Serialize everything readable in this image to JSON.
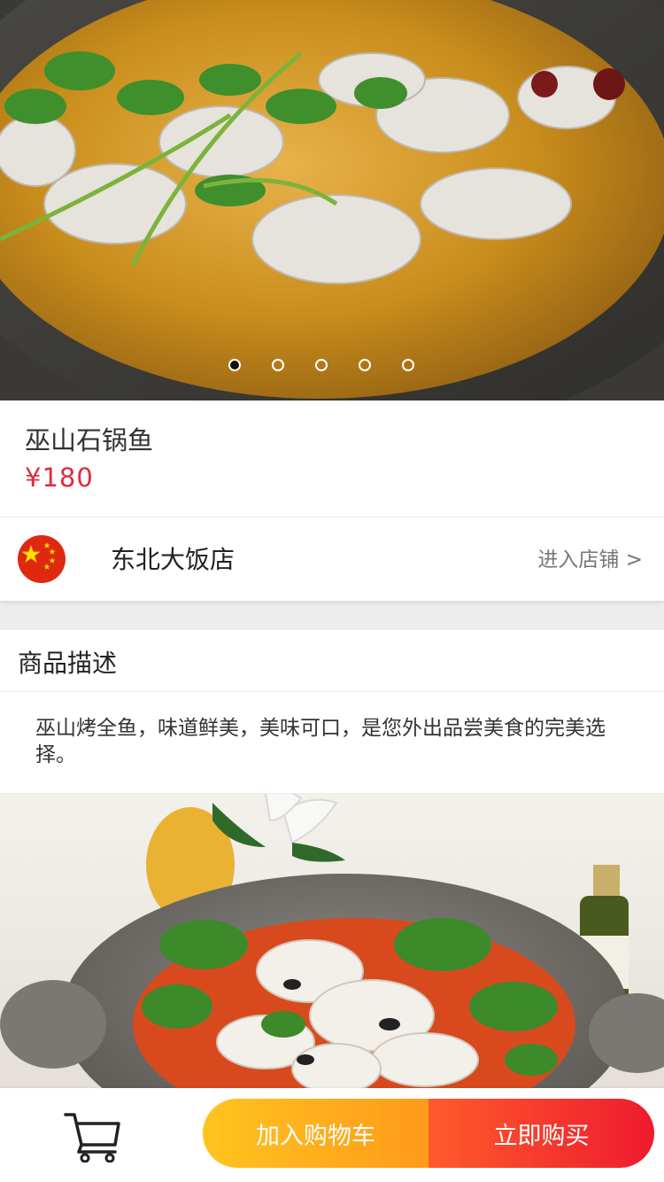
{
  "carousel": {
    "image_alt": "巫山石锅鱼",
    "slide_count": 5,
    "active_index": 0
  },
  "product": {
    "name": "巫山石锅鱼",
    "price": "¥180"
  },
  "shop": {
    "name": "东北大饭店",
    "enter_label": "进入店铺 >",
    "avatar_icon": "china-flag-icon"
  },
  "description": {
    "title": "商品描述",
    "text": "巫山烤全鱼，味道鲜美，美味可口，是您外出品尝美食的完美选择。"
  },
  "actions": {
    "cart_icon": "shopping-cart-icon",
    "add_to_cart": "加入购物车",
    "buy_now": "立即购买"
  },
  "colors": {
    "price": "#e02a3c",
    "add_to_cart_start": "#ffc41f",
    "add_to_cart_end": "#ff9a1a",
    "buy_now_start": "#ff5a2c",
    "buy_now_end": "#ee1b2e"
  }
}
